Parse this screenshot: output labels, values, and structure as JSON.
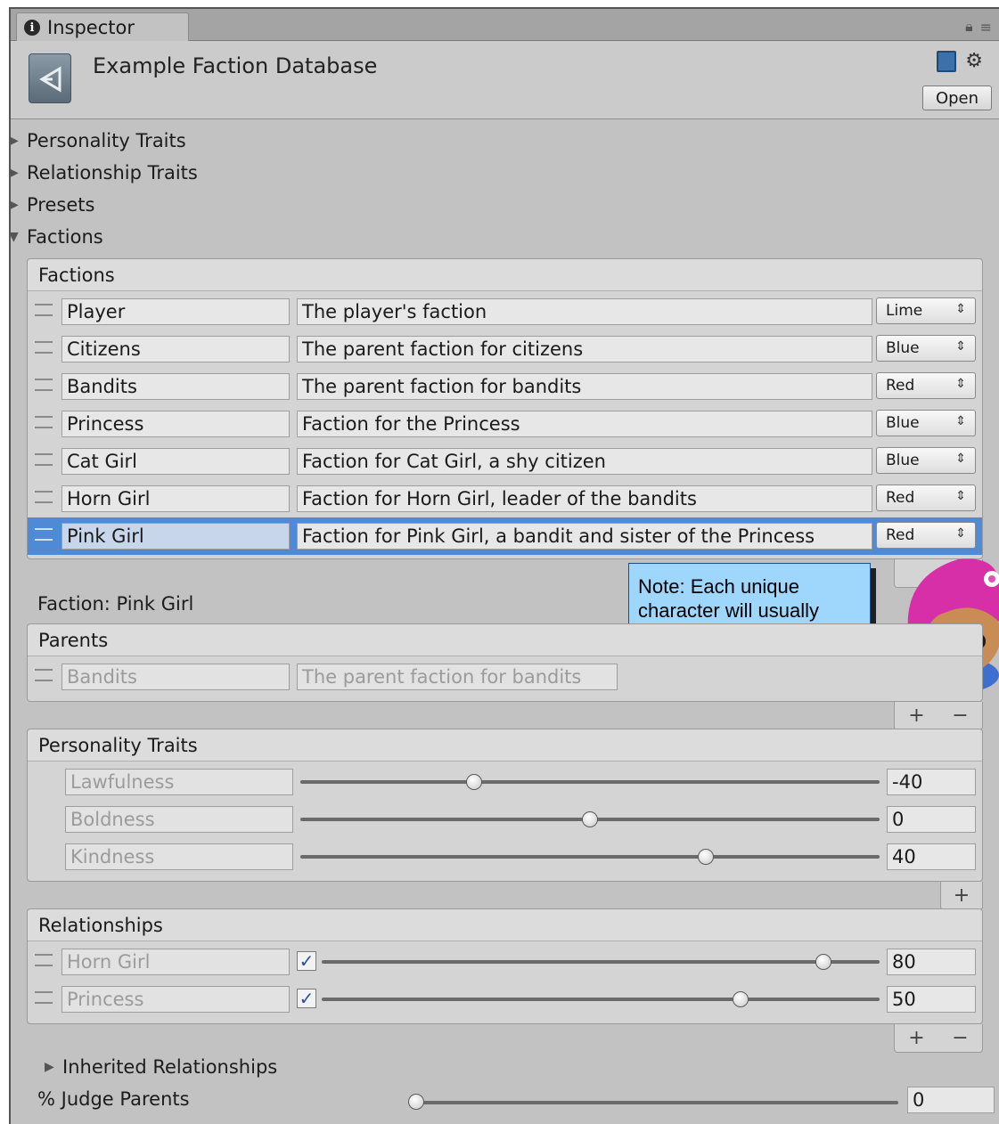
{
  "window": {
    "tab_label": "Inspector"
  },
  "header": {
    "asset_title": "Example Faction Database",
    "open_label": "Open"
  },
  "foldouts": [
    {
      "label": "Personality Traits",
      "expanded": false
    },
    {
      "label": "Relationship Traits",
      "expanded": false
    },
    {
      "label": "Presets",
      "expanded": false
    },
    {
      "label": "Factions",
      "expanded": true
    }
  ],
  "factions_list": {
    "title": "Factions",
    "rows": [
      {
        "name": "Player",
        "description": "The player's faction",
        "color": "Lime"
      },
      {
        "name": "Citizens",
        "description": "The parent faction for citizens",
        "color": "Blue"
      },
      {
        "name": "Bandits",
        "description": "The parent faction for bandits",
        "color": "Red"
      },
      {
        "name": "Princess",
        "description": "Faction for the Princess",
        "color": "Blue"
      },
      {
        "name": "Cat Girl",
        "description": "Faction for Cat Girl, a shy citizen",
        "color": "Blue"
      },
      {
        "name": "Horn Girl",
        "description": "Faction for Horn Girl, leader of the bandits",
        "color": "Red"
      },
      {
        "name": "Pink Girl",
        "description": "Faction for Pink Girl, a bandit and sister of the Princess",
        "color": "Red",
        "selected": true
      }
    ]
  },
  "selected_faction": {
    "heading": "Faction: Pink Girl",
    "parents": {
      "title": "Parents",
      "rows": [
        {
          "name": "Bandits",
          "description": "The parent faction for bandits"
        }
      ],
      "add_label": "+",
      "remove_label": "−"
    },
    "personality_traits": {
      "title": "Personality Traits",
      "rows": [
        {
          "name": "Lawfulness",
          "value": "-40",
          "fraction": 0.3
        },
        {
          "name": "Boldness",
          "value": "0",
          "fraction": 0.5
        },
        {
          "name": "Kindness",
          "value": "40",
          "fraction": 0.7
        }
      ],
      "add_label": "+"
    },
    "relationships": {
      "title": "Relationships",
      "rows": [
        {
          "name": "Horn Girl",
          "checked": true,
          "value": "80",
          "fraction": 0.9
        },
        {
          "name": "Princess",
          "checked": true,
          "value": "50",
          "fraction": 0.75
        }
      ],
      "add_label": "+",
      "remove_label": "−"
    },
    "inherited_label": "Inherited Relationships",
    "judge_parents": {
      "label": "% Judge Parents",
      "value": "0",
      "fraction": 0.0
    }
  },
  "note": {
    "text": "Note: Each unique character will usually have its own faction!"
  },
  "colors": {
    "selection": "#4f8ad6",
    "note_bg": "#9fd6fb",
    "panel": "#d4d4d4"
  }
}
